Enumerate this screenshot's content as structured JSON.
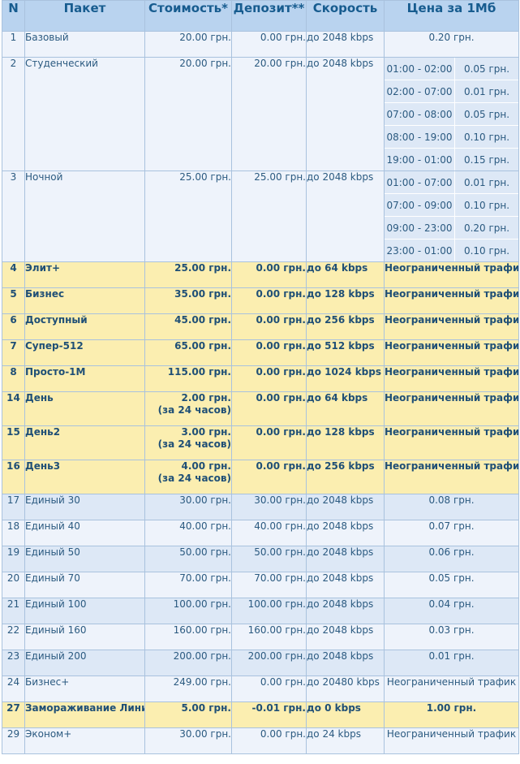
{
  "header": {
    "n": "N",
    "package": "Пакет",
    "cost": "Стоимость*",
    "deposit": "Депозит**",
    "speed": "Скорость",
    "price_mb": "Цена за 1Мб"
  },
  "rows": [
    {
      "n": "1",
      "name": "Базовый",
      "cost": "20.00 грн.",
      "deposit": "0.00 грн.",
      "speed": "до 2048 kbps",
      "price": "0.20 грн."
    },
    {
      "n": "2",
      "name": "Студенческий",
      "cost": "20.00 грн.",
      "deposit": "20.00 грн.",
      "speed": "до 2048 kbps",
      "schedule": [
        {
          "time": "01:00 - 02:00",
          "price": "0.05 грн."
        },
        {
          "time": "02:00 - 07:00",
          "price": "0.01 грн."
        },
        {
          "time": "07:00 - 08:00",
          "price": "0.05 грн."
        },
        {
          "time": "08:00 - 19:00",
          "price": "0.10 грн."
        },
        {
          "time": "19:00 - 01:00",
          "price": "0.15 грн."
        }
      ]
    },
    {
      "n": "3",
      "name": "Ночной",
      "cost": "25.00 грн.",
      "deposit": "25.00 грн.",
      "speed": "до 2048 kbps",
      "schedule": [
        {
          "time": "01:00 - 07:00",
          "price": "0.01 грн."
        },
        {
          "time": "07:00 - 09:00",
          "price": "0.10 грн."
        },
        {
          "time": "09:00 - 23:00",
          "price": "0.20 грн."
        },
        {
          "time": "23:00 - 01:00",
          "price": "0.10 грн."
        }
      ]
    },
    {
      "n": "4",
      "name": "Элит+",
      "cost": "25.00 грн.",
      "deposit": "0.00 грн.",
      "speed": "до 64 kbps",
      "price": "Неограниченный трафик"
    },
    {
      "n": "5",
      "name": "Бизнес",
      "cost": "35.00 грн.",
      "deposit": "0.00 грн.",
      "speed": "до 128 kbps",
      "price": "Неограниченный трафик"
    },
    {
      "n": "6",
      "name": "Доступный",
      "cost": "45.00 грн.",
      "deposit": "0.00 грн.",
      "speed": "до 256 kbps",
      "price": "Неограниченный трафик"
    },
    {
      "n": "7",
      "name": "Супер-512",
      "cost": "65.00 грн.",
      "deposit": "0.00 грн.",
      "speed": "до 512 kbps",
      "price": "Неограниченный трафик"
    },
    {
      "n": "8",
      "name": "Просто-1М",
      "cost": "115.00 грн.",
      "deposit": "0.00 грн.",
      "speed": "до 1024 kbps",
      "price": "Неограниченный трафик"
    },
    {
      "n": "14",
      "name": "День",
      "cost": "2.00 грн.",
      "cost_note": "(за 24 часов)",
      "deposit": "0.00 грн.",
      "speed": "до 64 kbps",
      "price": "Неограниченный трафик"
    },
    {
      "n": "15",
      "name": "День2",
      "cost": "3.00 грн.",
      "cost_note": "(за 24 часов)",
      "deposit": "0.00 грн.",
      "speed": "до 128 kbps",
      "price": "Неограниченный трафик"
    },
    {
      "n": "16",
      "name": "День3",
      "cost": "4.00 грн.",
      "cost_note": "(за 24 часов)",
      "deposit": "0.00 грн.",
      "speed": "до 256 kbps",
      "price": "Неограниченный трафик"
    },
    {
      "n": "17",
      "name": "Единый 30",
      "cost": "30.00 грн.",
      "deposit": "30.00 грн.",
      "speed": "до 2048 kbps",
      "price": "0.08 грн."
    },
    {
      "n": "18",
      "name": "Единый 40",
      "cost": "40.00 грн.",
      "deposit": "40.00 грн.",
      "speed": "до 2048 kbps",
      "price": "0.07 грн."
    },
    {
      "n": "19",
      "name": "Единый 50",
      "cost": "50.00 грн.",
      "deposit": "50.00 грн.",
      "speed": "до 2048 kbps",
      "price": "0.06 грн."
    },
    {
      "n": "20",
      "name": "Единый 70",
      "cost": "70.00 грн.",
      "deposit": "70.00 грн.",
      "speed": "до 2048 kbps",
      "price": "0.05 грн."
    },
    {
      "n": "21",
      "name": "Единый 100",
      "cost": "100.00 грн.",
      "deposit": "100.00 грн.",
      "speed": "до 2048 kbps",
      "price": "0.04 грн."
    },
    {
      "n": "22",
      "name": "Единый 160",
      "cost": "160.00 грн.",
      "deposit": "160.00 грн.",
      "speed": "до 2048 kbps",
      "price": "0.03 грн."
    },
    {
      "n": "23",
      "name": "Единый 200",
      "cost": "200.00 грн.",
      "deposit": "200.00 грн.",
      "speed": "до 2048 kbps",
      "price": "0.01 грн."
    },
    {
      "n": "24",
      "name": "Бизнес+",
      "cost": "249.00 грн.",
      "deposit": "0.00 грн.",
      "speed": "до 20480 kbps",
      "price": "Неограниченный трафик"
    },
    {
      "n": "27",
      "name": "Замораживание Линии",
      "cost": "5.00 грн.",
      "deposit": "-0.01 грн.",
      "speed": "до 0 kbps",
      "price": "1.00 грн."
    },
    {
      "n": "29",
      "name": "Эконом+",
      "cost": "30.00 грн.",
      "deposit": "0.00 грн.",
      "speed": "до 24 kbps",
      "price": "Неограниченный трафик"
    }
  ],
  "colors": {
    "header_bg": "#b9d3ef",
    "highlight_bg": "#fbeeb0",
    "row_light": "#eef3fb",
    "row_blue": "#dde8f6",
    "text": "#2b5a80"
  }
}
